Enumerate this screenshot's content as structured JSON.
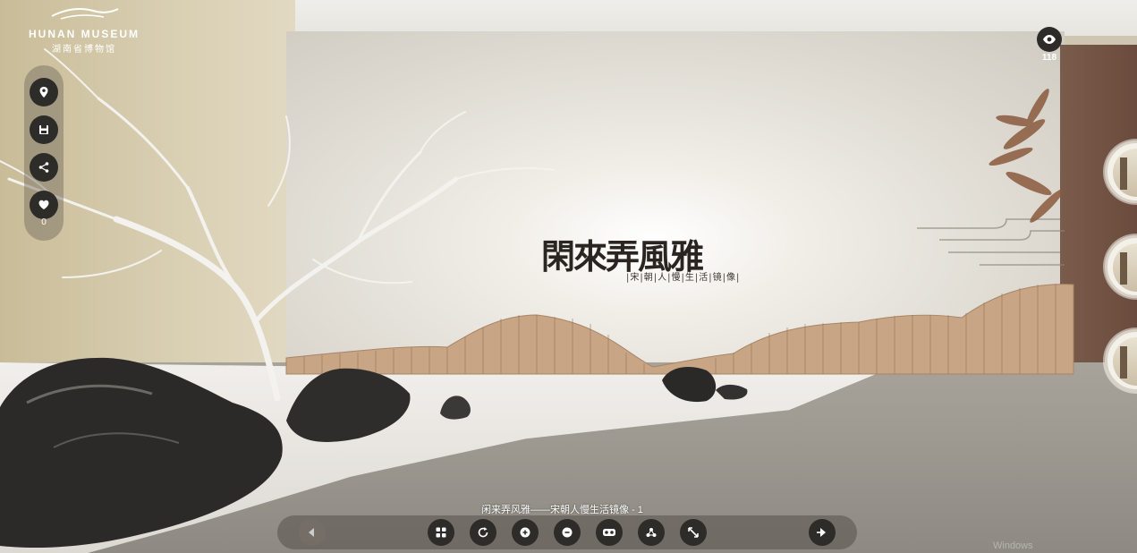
{
  "logo": {
    "english": "HUNAN MUSEUM",
    "chinese": "湖南省博物馆"
  },
  "side_toolbar": {
    "buttons": [
      {
        "name": "map-pin-icon",
        "label": ""
      },
      {
        "name": "save-icon",
        "label": ""
      },
      {
        "name": "share-icon",
        "label": ""
      },
      {
        "name": "heart-icon",
        "label": ""
      }
    ],
    "like_count": "0"
  },
  "views": {
    "icon": "eye-icon",
    "count": "118"
  },
  "scene": {
    "wall_title": "閑來弄風雅",
    "wall_subtitle": "|宋|朝|人|慢|生|活|镜|像|",
    "caption": "闲来弄风雅——宋朝人慢生活镜像 - 1"
  },
  "bottom_toolbar": {
    "buttons": [
      {
        "name": "prev-arrow-icon",
        "state": "disabled"
      },
      {
        "name": "grid-icon"
      },
      {
        "name": "rotate-icon"
      },
      {
        "name": "zoom-in-icon"
      },
      {
        "name": "zoom-out-icon"
      },
      {
        "name": "vr-glasses-icon"
      },
      {
        "name": "gyroscope-icon"
      },
      {
        "name": "fullscreen-icon"
      },
      {
        "name": "next-arrow-icon"
      }
    ]
  },
  "watermark": "Windows",
  "colors": {
    "button_bg": "#2e2c29",
    "toolbar_bg": "rgba(85,80,72,0.55)",
    "text": "#ffffff"
  }
}
